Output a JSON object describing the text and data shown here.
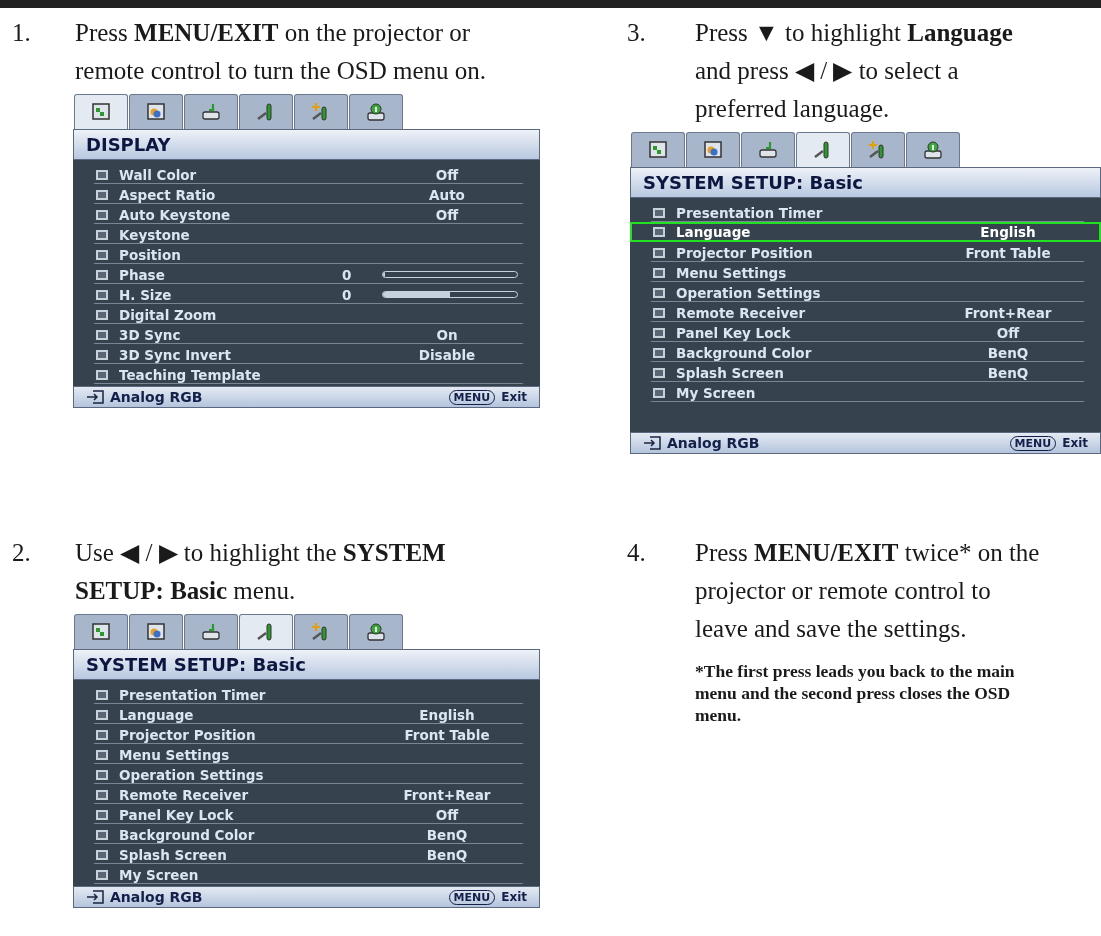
{
  "steps": [
    {
      "number": "1.",
      "text": "Press **MENU/EXIT** on the projector or remote control to turn the OSD menu on.",
      "menu": {
        "tabs": [
          {
            "kind": "display",
            "selected": true
          },
          {
            "kind": "picture",
            "selected": false
          },
          {
            "kind": "source",
            "selected": false
          },
          {
            "kind": "system",
            "selected": false
          },
          {
            "kind": "advanced",
            "selected": false
          },
          {
            "kind": "info",
            "selected": false
          }
        ],
        "title": "DISPLAY",
        "rows": [
          {
            "label": "Wall Color",
            "value": "Off",
            "selected": false
          },
          {
            "label": "Aspect Ratio",
            "value": "Auto",
            "selected": false
          },
          {
            "label": "Auto Keystone",
            "value": "Off",
            "selected": false
          },
          {
            "label": "Keystone",
            "selected": false
          },
          {
            "label": "Position",
            "selected": false
          },
          {
            "label": "Phase",
            "value": "0",
            "level": 0,
            "selected": false
          },
          {
            "label": "H. Size",
            "value": "0",
            "level": 0.5,
            "selected": false
          },
          {
            "label": "Digital Zoom",
            "selected": false
          },
          {
            "label": "3D Sync",
            "value": "On",
            "selected": false
          },
          {
            "label": "3D Sync Invert",
            "value": "Disable",
            "selected": false
          },
          {
            "label": "Teaching Template",
            "selected": false
          }
        ],
        "source": "Analog RGB",
        "menu_key": "MENU",
        "exit": "Exit"
      }
    },
    {
      "number": "3.",
      "text": "Press ▼ to highlight **Language** and press ◀ / ▶ to select a preferred language.",
      "menu": {
        "tabs": [
          {
            "kind": "display",
            "selected": false
          },
          {
            "kind": "picture",
            "selected": false
          },
          {
            "kind": "source",
            "selected": false
          },
          {
            "kind": "system",
            "selected": true
          },
          {
            "kind": "advanced",
            "selected": false
          },
          {
            "kind": "info",
            "selected": false
          }
        ],
        "title": "SYSTEM SETUP: Basic",
        "rows": [
          {
            "label": "Presentation Timer",
            "selected": false
          },
          {
            "label": "Language",
            "value": "English",
            "selected": true
          },
          {
            "label": "Projector Position",
            "value": "Front Table",
            "selected": false
          },
          {
            "label": "Menu Settings",
            "selected": false
          },
          {
            "label": "Operation Settings",
            "selected": false
          },
          {
            "label": "Remote Receiver",
            "value": "Front+Rear",
            "selected": false
          },
          {
            "label": "Panel Key Lock",
            "value": "Off",
            "selected": false
          },
          {
            "label": "Background Color",
            "value": "BenQ",
            "selected": false
          },
          {
            "label": "Splash Screen",
            "value": "BenQ",
            "selected": false
          },
          {
            "label": "My Screen",
            "selected": false
          }
        ],
        "source": "Analog RGB",
        "menu_key": "MENU",
        "exit": "Exit"
      }
    },
    {
      "number": "2.",
      "text": "Use ◀ / ▶ to highlight the **SYSTEM SETUP: Basic** menu.",
      "menu": {
        "tabs": [
          {
            "kind": "display",
            "selected": false
          },
          {
            "kind": "picture",
            "selected": false
          },
          {
            "kind": "source",
            "selected": false
          },
          {
            "kind": "system",
            "selected": true
          },
          {
            "kind": "advanced",
            "selected": false
          },
          {
            "kind": "info",
            "selected": false
          }
        ],
        "title": "SYSTEM SETUP: Basic",
        "rows": [
          {
            "label": "Presentation Timer",
            "selected": false
          },
          {
            "label": "Language",
            "value": "English",
            "selected": false
          },
          {
            "label": "Projector Position",
            "value": "Front Table",
            "selected": false
          },
          {
            "label": "Menu Settings",
            "selected": false
          },
          {
            "label": "Operation Settings",
            "selected": false
          },
          {
            "label": "Remote Receiver",
            "value": "Front+Rear",
            "selected": false
          },
          {
            "label": "Panel Key Lock",
            "value": "Off",
            "selected": false
          },
          {
            "label": "Background Color",
            "value": "BenQ",
            "selected": false
          },
          {
            "label": "Splash Screen",
            "value": "BenQ",
            "selected": false
          },
          {
            "label": "My Screen",
            "selected": false
          }
        ],
        "source": "Analog RGB",
        "menu_key": "MENU",
        "exit": "Exit"
      }
    },
    {
      "number": "4.",
      "text": "Press **MENU/EXIT** twice* on the projector or remote control to leave and save the settings.",
      "note": "*The first press leads you back to the main menu and the second press closes the OSD menu."
    }
  ]
}
